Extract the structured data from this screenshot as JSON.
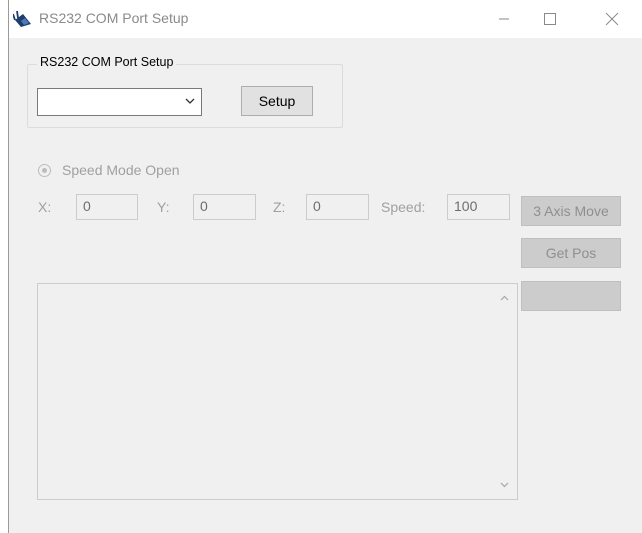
{
  "window": {
    "title": "RS232 COM Port Setup"
  },
  "setup_group": {
    "legend": "RS232 COM Port Setup",
    "port_value": "",
    "setup_button": "Setup"
  },
  "motion": {
    "radio_label": "Speed Mode Open",
    "x_label": "X:",
    "x_value": "0",
    "y_label": "Y:",
    "y_value": "0",
    "z_label": "Z:",
    "z_value": "0",
    "speed_label": "Speed:",
    "speed_value": "100"
  },
  "buttons": {
    "move": "3 Axis Move",
    "get_pos": "Get Pos",
    "blank": ""
  },
  "log": {
    "text": ""
  },
  "colors": {
    "window_bg": "#f0f0f0",
    "disabled_text": "#a0a0a0",
    "disabled_button": "#cccccc"
  }
}
